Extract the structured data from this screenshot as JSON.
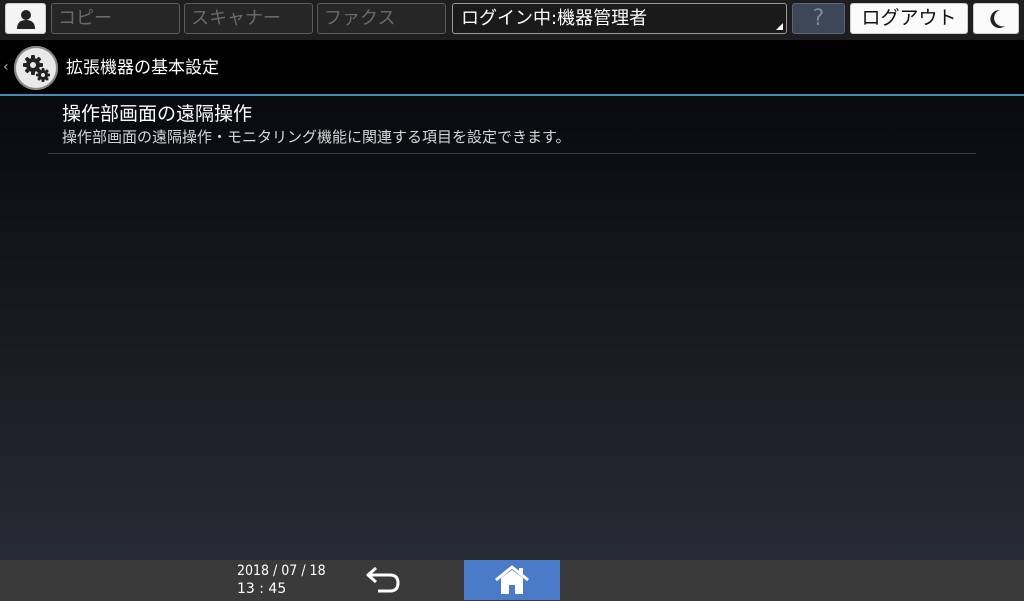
{
  "topbar": {
    "user_icon": "person-icon",
    "app_tabs": [
      "コピー",
      "スキャナー",
      "ファクス"
    ],
    "login_status": "ログイン中:機器管理者",
    "help_label": "?",
    "logout_label": "ログアウト",
    "sleep_icon": "crescent-moon-icon"
  },
  "header": {
    "back_icon": "chevron-left-icon",
    "settings_icon": "gears-icon",
    "title": "拡張機器の基本設定"
  },
  "main": {
    "items": [
      {
        "title": "操作部画面の遠隔操作",
        "description": "操作部画面の遠隔操作・モニタリング機能に関連する項目を設定できます。"
      }
    ]
  },
  "footer": {
    "date": "2018 / 07 / 18",
    "time": "13 : 45",
    "back_icon": "return-arrow-icon",
    "home_icon": "home-icon"
  },
  "colors": {
    "accent_line": "#3d8fb8",
    "home_button": "#4a7bc8"
  }
}
